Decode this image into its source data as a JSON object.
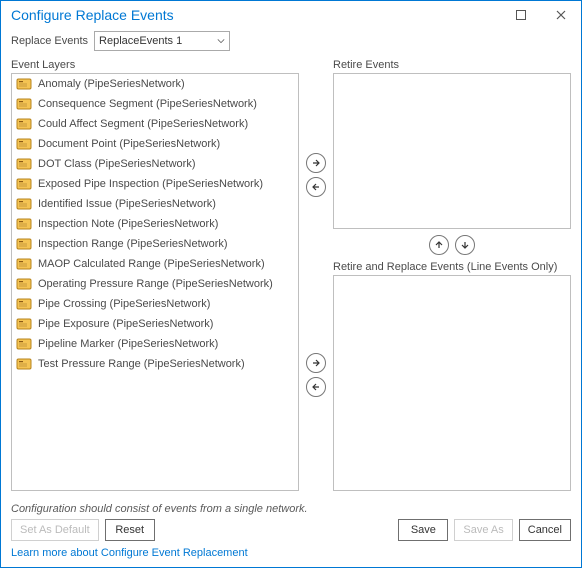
{
  "titlebar": {
    "title": "Configure Replace Events"
  },
  "toprow": {
    "label": "Replace Events",
    "selected": "ReplaceEvents 1"
  },
  "left": {
    "header": "Event Layers",
    "items": [
      "Anomaly (PipeSeriesNetwork)",
      "Consequence Segment (PipeSeriesNetwork)",
      "Could Affect Segment (PipeSeriesNetwork)",
      "Document Point (PipeSeriesNetwork)",
      "DOT Class (PipeSeriesNetwork)",
      "Exposed Pipe Inspection (PipeSeriesNetwork)",
      "Identified Issue (PipeSeriesNetwork)",
      "Inspection Note (PipeSeriesNetwork)",
      "Inspection Range (PipeSeriesNetwork)",
      "MAOP Calculated Range (PipeSeriesNetwork)",
      "Operating Pressure Range (PipeSeriesNetwork)",
      "Pipe Crossing (PipeSeriesNetwork)",
      "Pipe Exposure (PipeSeriesNetwork)",
      "Pipeline Marker (PipeSeriesNetwork)",
      "Test Pressure Range (PipeSeriesNetwork)"
    ]
  },
  "right": {
    "retire_header": "Retire Events",
    "replace_header": "Retire and Replace Events (Line Events Only)"
  },
  "hint": "Configuration should consist of events from a single network.",
  "footer": {
    "set_default": "Set As Default",
    "reset": "Reset",
    "save": "Save",
    "save_as": "Save As",
    "cancel": "Cancel"
  },
  "link": "Learn more about Configure Event Replacement"
}
